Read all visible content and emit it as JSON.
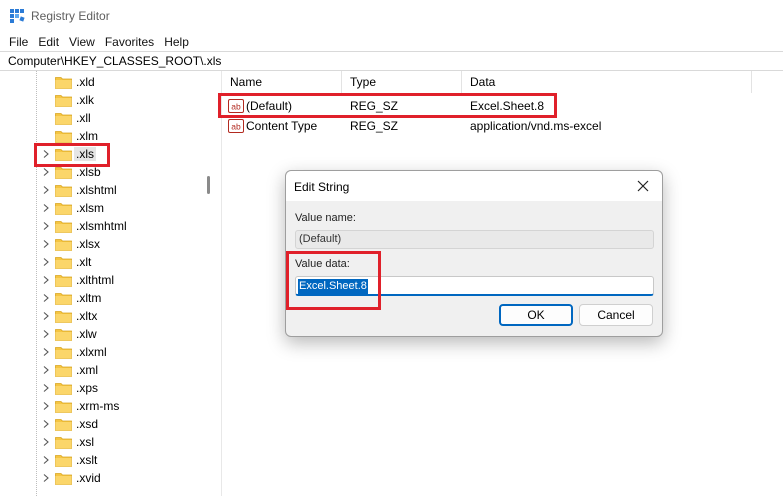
{
  "window": {
    "title": "Registry Editor"
  },
  "menu": [
    "File",
    "Edit",
    "View",
    "Favorites",
    "Help"
  ],
  "address": "Computer\\HKEY_CLASSES_ROOT\\.xls",
  "tree": {
    "items": [
      ".xld",
      ".xlk",
      ".xll",
      ".xlm",
      ".xls",
      ".xlsb",
      ".xlshtml",
      ".xlsm",
      ".xlsmhtml",
      ".xlsx",
      ".xlt",
      ".xlthtml",
      ".xltm",
      ".xltx",
      ".xlw",
      ".xlxml",
      ".xml",
      ".xps",
      ".xrm-ms",
      ".xsd",
      ".xsl",
      ".xslt",
      ".xvid"
    ],
    "selected_index": 4
  },
  "list": {
    "columns": [
      "Name",
      "Type",
      "Data"
    ],
    "rows": [
      {
        "name": "(Default)",
        "type": "REG_SZ",
        "data": "Excel.Sheet.8"
      },
      {
        "name": "Content Type",
        "type": "REG_SZ",
        "data": "application/vnd.ms-excel"
      }
    ]
  },
  "dialog": {
    "title": "Edit String",
    "value_name_label": "Value name:",
    "value_name": "(Default)",
    "value_data_label": "Value data:",
    "value_data": "Excel.Sheet.8",
    "ok_label": "OK",
    "cancel_label": "Cancel"
  },
  "colors": {
    "highlight_box": "#e0202a",
    "folder": "#f5c542",
    "accent": "#0067c0"
  },
  "icons": {
    "app": "registry-editor-icon",
    "folder": "folder-icon",
    "string_value": "ab-string-value-icon",
    "expand": "chevron-right-icon",
    "close": "close-icon"
  }
}
